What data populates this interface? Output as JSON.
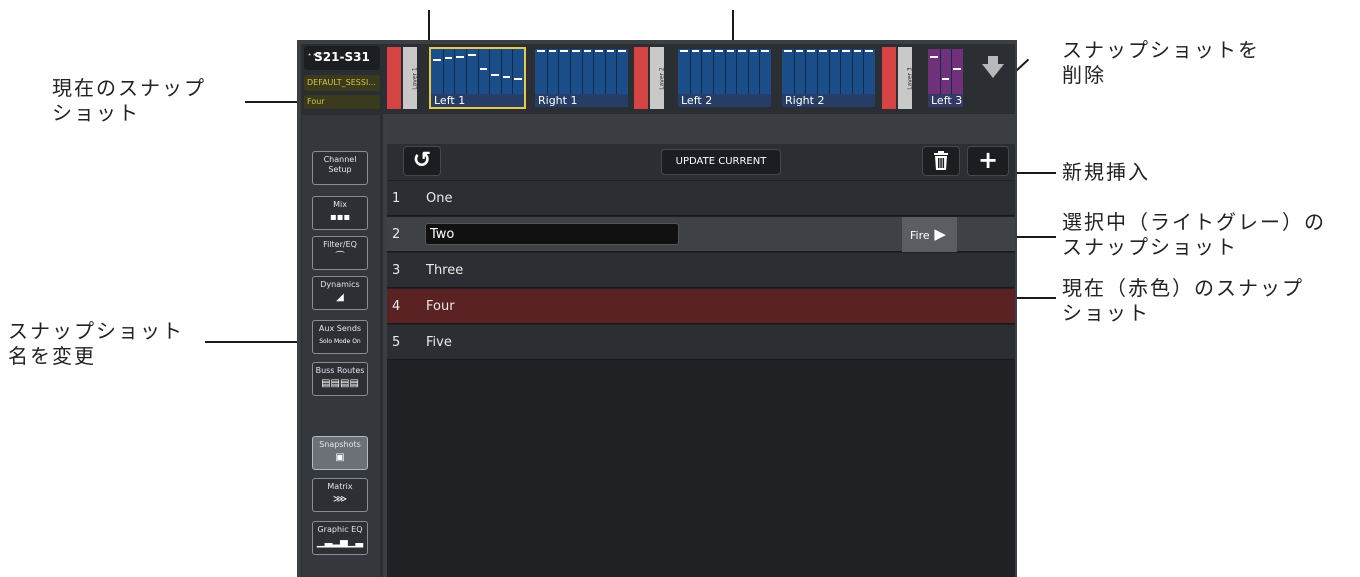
{
  "annotations": {
    "current_snapshot": "現在のスナップ\nショット",
    "delete_snapshot": "スナップショットを\n削除",
    "new_insert": "新規挿入",
    "selected": "選択中（ライトグレー）の\nスナップショット",
    "current_red": "現在（赤色）のスナップ\nショット",
    "rename": "スナップショット\n名を変更"
  },
  "header": {
    "console_id": "S21-S31",
    "session": "DEFAULT_SESSI...",
    "current_snapshot": "Four"
  },
  "layers": [
    {
      "label": "Layer 1"
    },
    {
      "label": "Layer 2"
    },
    {
      "label": "Layer 3"
    }
  ],
  "banks": [
    {
      "label": "Left 1",
      "selected": true,
      "faders": [
        0.78,
        0.82,
        0.86,
        0.9,
        0.55,
        0.4,
        0.35,
        0.3
      ]
    },
    {
      "label": "Right 1",
      "selected": false,
      "faders": [
        1,
        1,
        1,
        1,
        1,
        1,
        1,
        1
      ]
    },
    {
      "label": "Left 2",
      "selected": false,
      "faders": [
        1,
        1,
        1,
        1,
        1,
        1,
        1,
        1
      ]
    },
    {
      "label": "Right 2",
      "selected": false,
      "faders": [
        1,
        1,
        1,
        1,
        1,
        1,
        1,
        1
      ]
    },
    {
      "label": "Left 3",
      "selected": false,
      "faders": [
        0.85,
        0.3,
        0.55
      ]
    }
  ],
  "nav": [
    {
      "label": "Channel\nSetup",
      "icon": "",
      "active": false
    },
    {
      "label": "Mix",
      "icon": "▪▪▪",
      "active": false
    },
    {
      "label": "Filter/EQ",
      "icon": "⁀",
      "active": false
    },
    {
      "label": "Dynamics",
      "icon": "◢",
      "active": false
    },
    {
      "label": "Aux Sends",
      "icon": "Solo Mode On",
      "active": false
    },
    {
      "label": "Buss Routes",
      "icon": "▤▤▤▤",
      "active": false
    },
    {
      "label": "Snapshots",
      "icon": "▣",
      "active": true
    },
    {
      "label": "Matrix",
      "icon": "⋙",
      "active": false
    },
    {
      "label": "Graphic EQ",
      "icon": "▁▃▂▅▁▃",
      "active": false
    }
  ],
  "toolbar": {
    "undo_icon": "↺",
    "update_label": "UPDATE CURRENT",
    "delete_icon": "trash-icon",
    "add_icon": "+"
  },
  "snapshots": [
    {
      "num": "1",
      "name": "One",
      "state": "normal"
    },
    {
      "num": "2",
      "name": "Two",
      "state": "selected",
      "fire_label": "Fire"
    },
    {
      "num": "3",
      "name": "Three",
      "state": "normal"
    },
    {
      "num": "4",
      "name": "Four",
      "state": "current"
    },
    {
      "num": "5",
      "name": "Five",
      "state": "normal"
    }
  ],
  "colors": {
    "current_row": "#5a2223",
    "selected_row": "#3e4146",
    "normal_row": "#2b2e32",
    "layer_red": "#d64343",
    "bank_blue": "#1b4e88",
    "select_yellow": "#e6c94a"
  }
}
